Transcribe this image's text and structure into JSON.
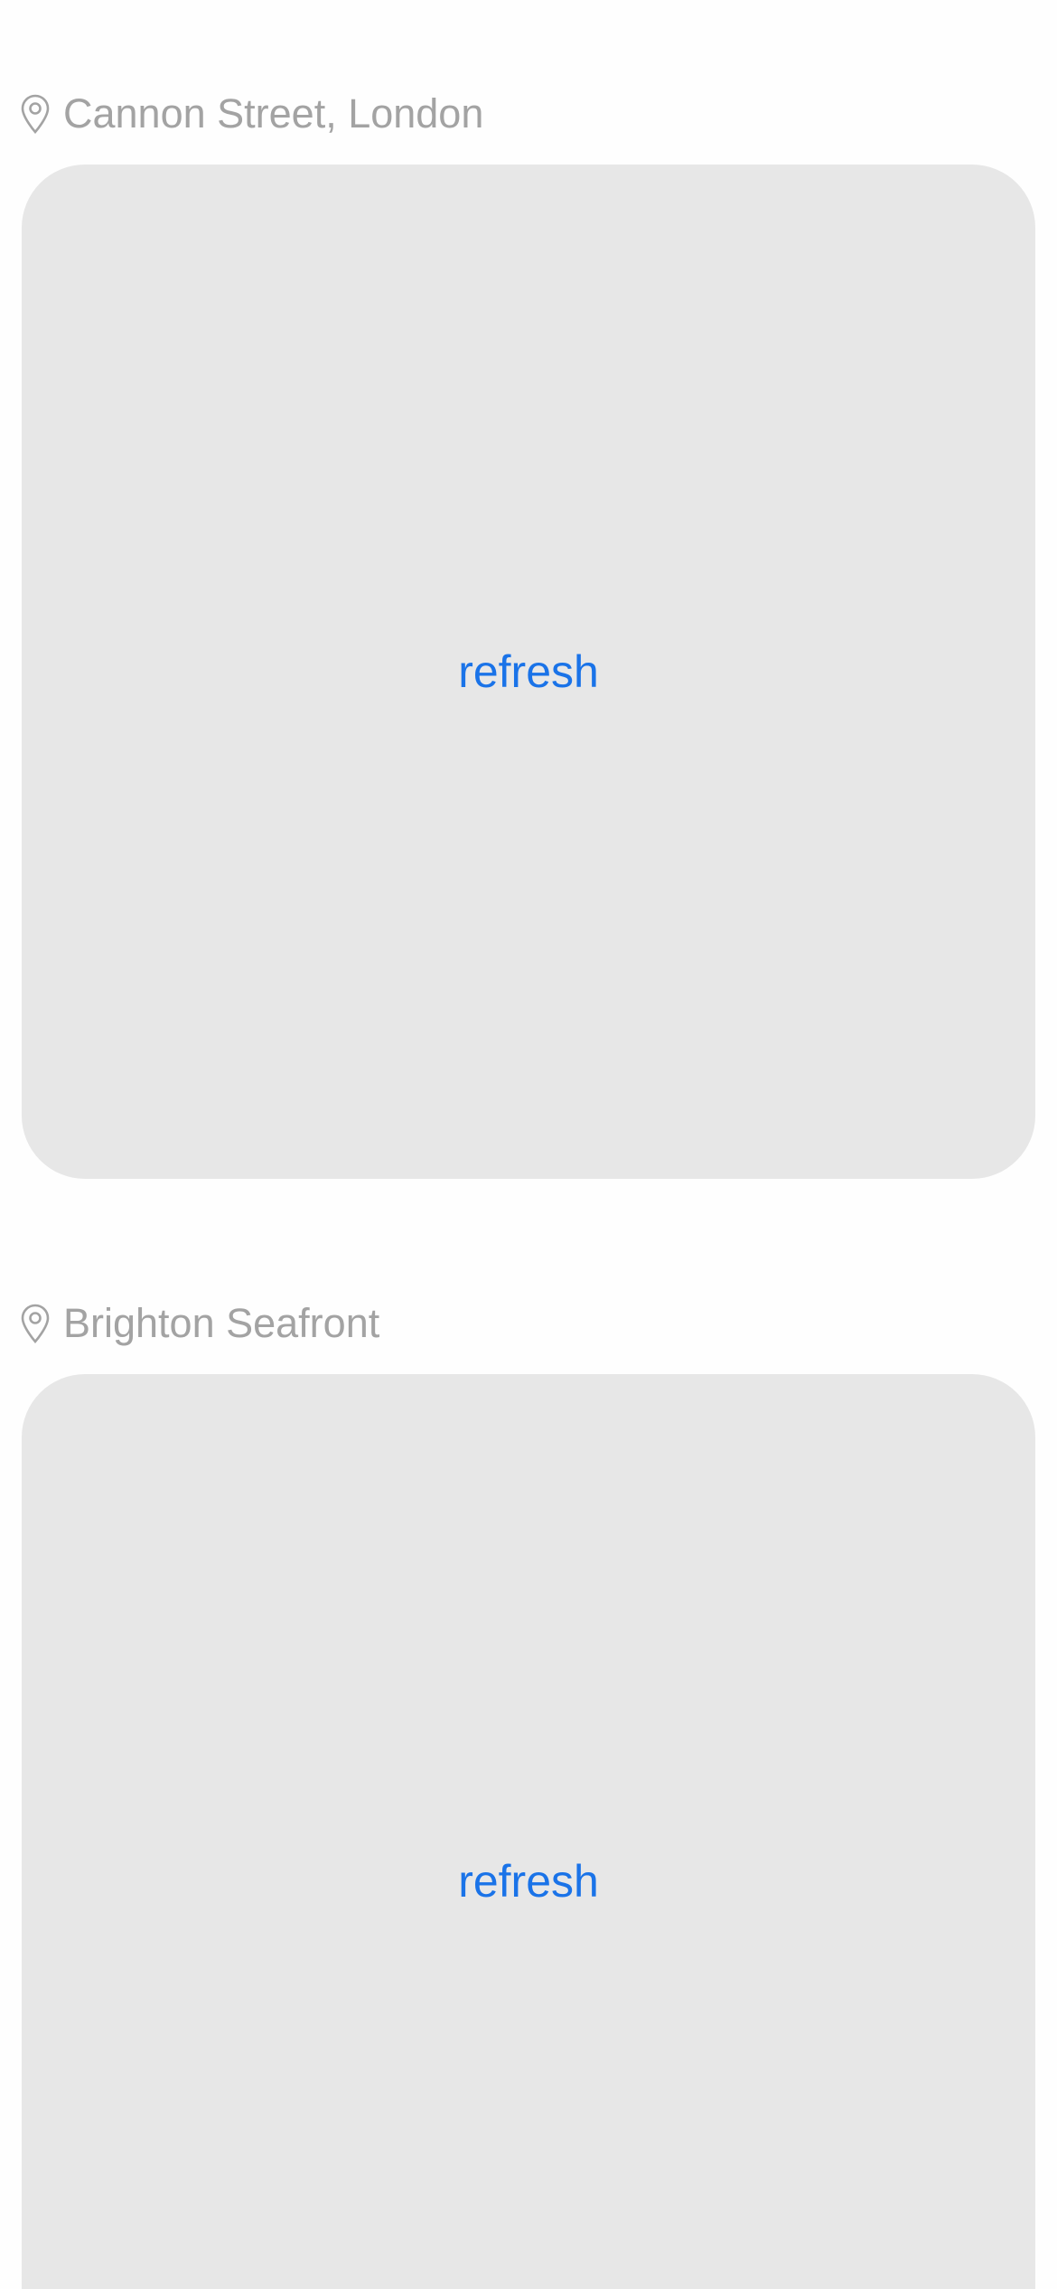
{
  "colors": {
    "background": "#fefefe",
    "card": "#e7e7e7",
    "location_text": "#a3a3a3",
    "accent": "#1a73e8"
  },
  "feeds": [
    {
      "location": "Cannon Street, London",
      "location_icon": "map-pin-icon",
      "refresh_label": "refresh"
    },
    {
      "location": "Brighton Seafront",
      "location_icon": "map-pin-icon",
      "refresh_label": "refresh"
    }
  ]
}
